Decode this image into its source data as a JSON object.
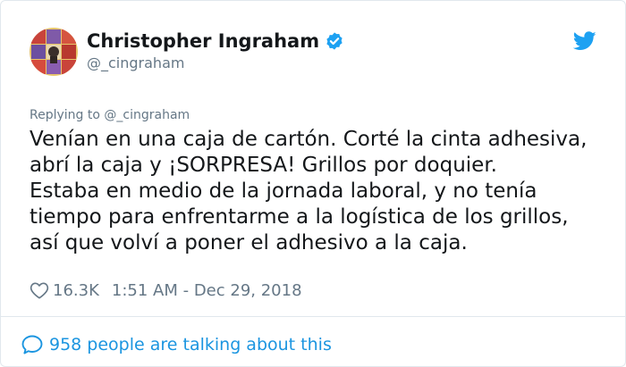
{
  "author": {
    "display_name": "Christopher Ingraham",
    "handle": "@_cingraham",
    "verified_icon": "verified-badge-icon",
    "avatar_icon": "avatar"
  },
  "brand": {
    "icon": "twitter-bird-icon",
    "color": "#1da1f2"
  },
  "reply": {
    "prefix": "Replying to",
    "handle": "@_cingraham"
  },
  "tweet": {
    "text": "Venían en una caja de cartón. Corté la cinta adhesiva,\nabrí la caja y ¡SORPRESA! Grillos por doquier.\nEstaba en medio de la jornada laboral, y no tenía\ntiempo para  enfrentarme  a la logística de los grillos,\nasí que volví a poner el adhesivo a la caja."
  },
  "meta": {
    "likes": "16.3K",
    "timestamp": "1:51 AM - Dec 29, 2018",
    "like_icon": "heart-icon"
  },
  "footer": {
    "conversation_text": "958 people are talking about this",
    "icon": "speech-bubble-icon"
  },
  "colors": {
    "link_blue": "#1b95e0",
    "muted_gray": "#657786",
    "text_dark": "#14171a",
    "border": "#e1e8ed"
  }
}
